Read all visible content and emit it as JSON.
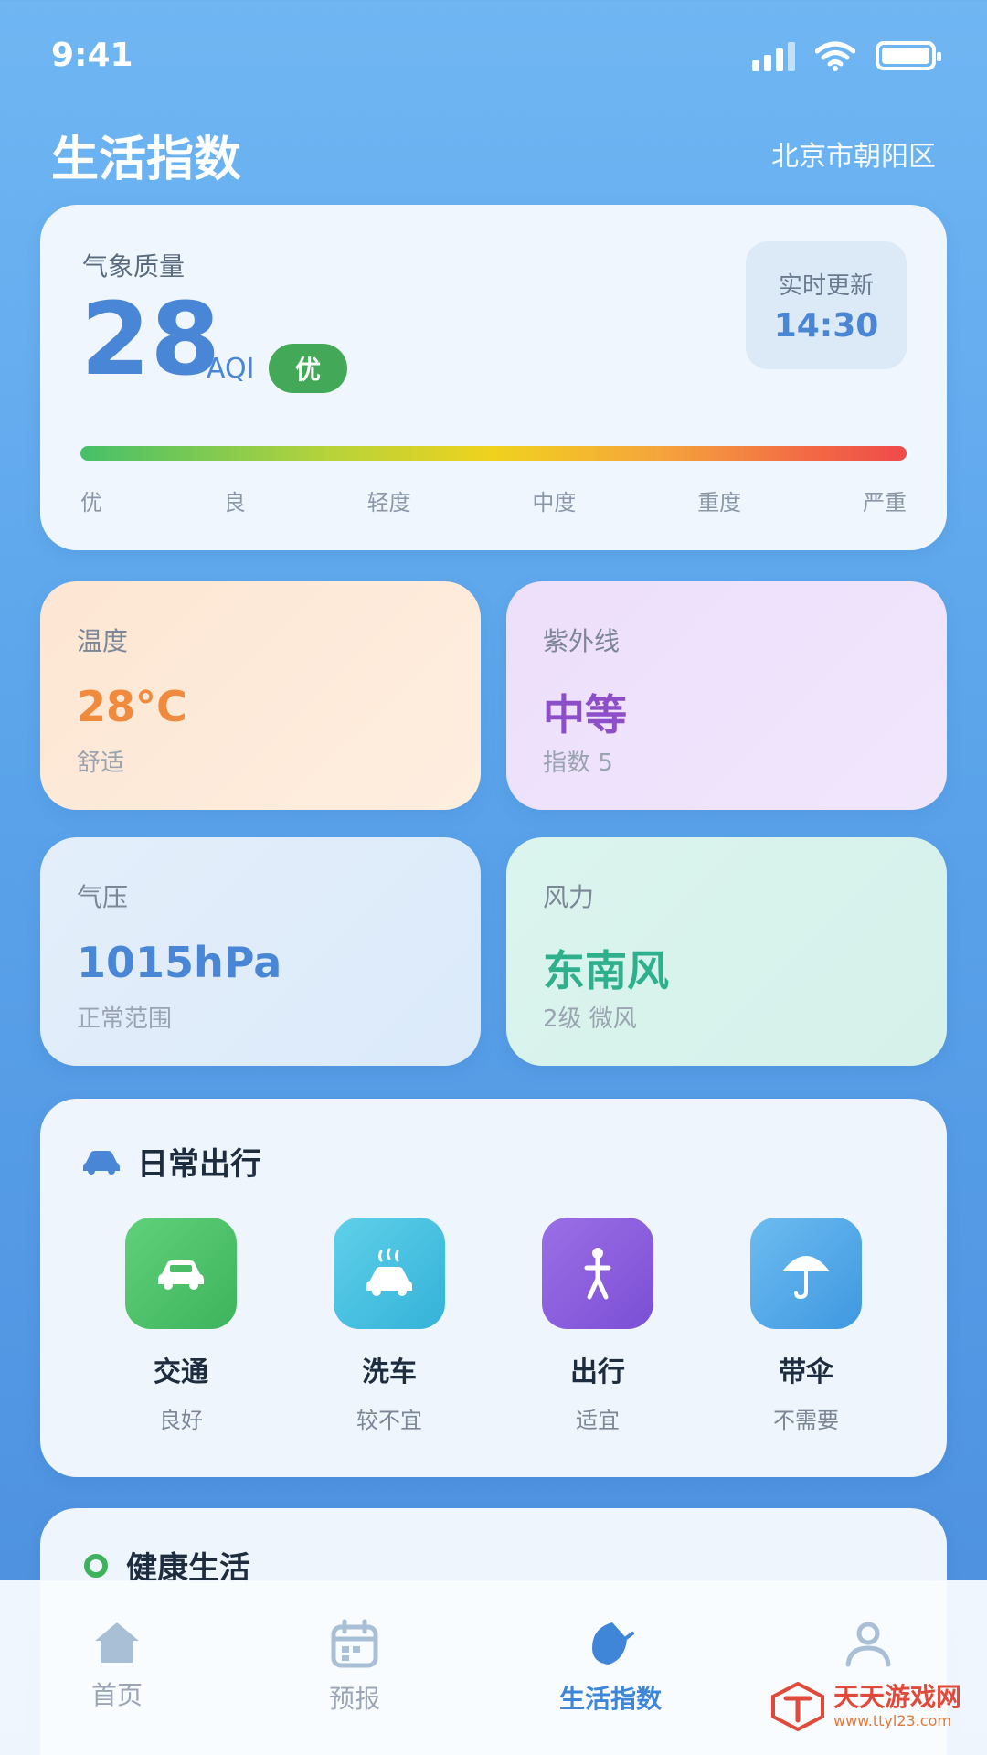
{
  "status": {
    "time": "9:41"
  },
  "header": {
    "title": "生活指数",
    "location": "北京市朝阳区"
  },
  "aqi": {
    "label": "气象质量",
    "value": "28",
    "unit": "AQI",
    "level": "优",
    "update_label": "实时更新",
    "update_time": "14:30",
    "scale": [
      "优",
      "良",
      "轻度",
      "中度",
      "重度",
      "严重"
    ]
  },
  "cards": {
    "temperature": {
      "label": "温度",
      "value": "28°C",
      "sub": "舒适",
      "color": "#f08a3c"
    },
    "uv": {
      "label": "紫外线",
      "value": "中等",
      "sub": "指数 5",
      "color": "#8d4fc8"
    },
    "pressure": {
      "label": "气压",
      "value": "1015hPa",
      "sub": "正常范围",
      "color": "#4a86d6"
    },
    "wind": {
      "label": "风力",
      "value": "东南风",
      "sub": "2级 微风",
      "color": "#2fb08d"
    }
  },
  "travel": {
    "title": "日常出行",
    "items": [
      {
        "title": "交通",
        "status": "良好",
        "icon": "car-icon"
      },
      {
        "title": "洗车",
        "status": "较不宜",
        "icon": "car-wash-icon"
      },
      {
        "title": "出行",
        "status": "适宜",
        "icon": "person-icon"
      },
      {
        "title": "带伞",
        "status": "不需要",
        "icon": "umbrella-icon"
      }
    ]
  },
  "health": {
    "title": "健康生活"
  },
  "tabs": [
    {
      "label": "首页",
      "icon": "home-icon"
    },
    {
      "label": "预报",
      "icon": "calendar-icon"
    },
    {
      "label": "生活指数",
      "icon": "leaf-icon",
      "active": true
    },
    {
      "label": "",
      "icon": "profile-icon"
    }
  ],
  "watermark": {
    "title": "天天游戏网",
    "url": "www.ttyl23.com"
  }
}
